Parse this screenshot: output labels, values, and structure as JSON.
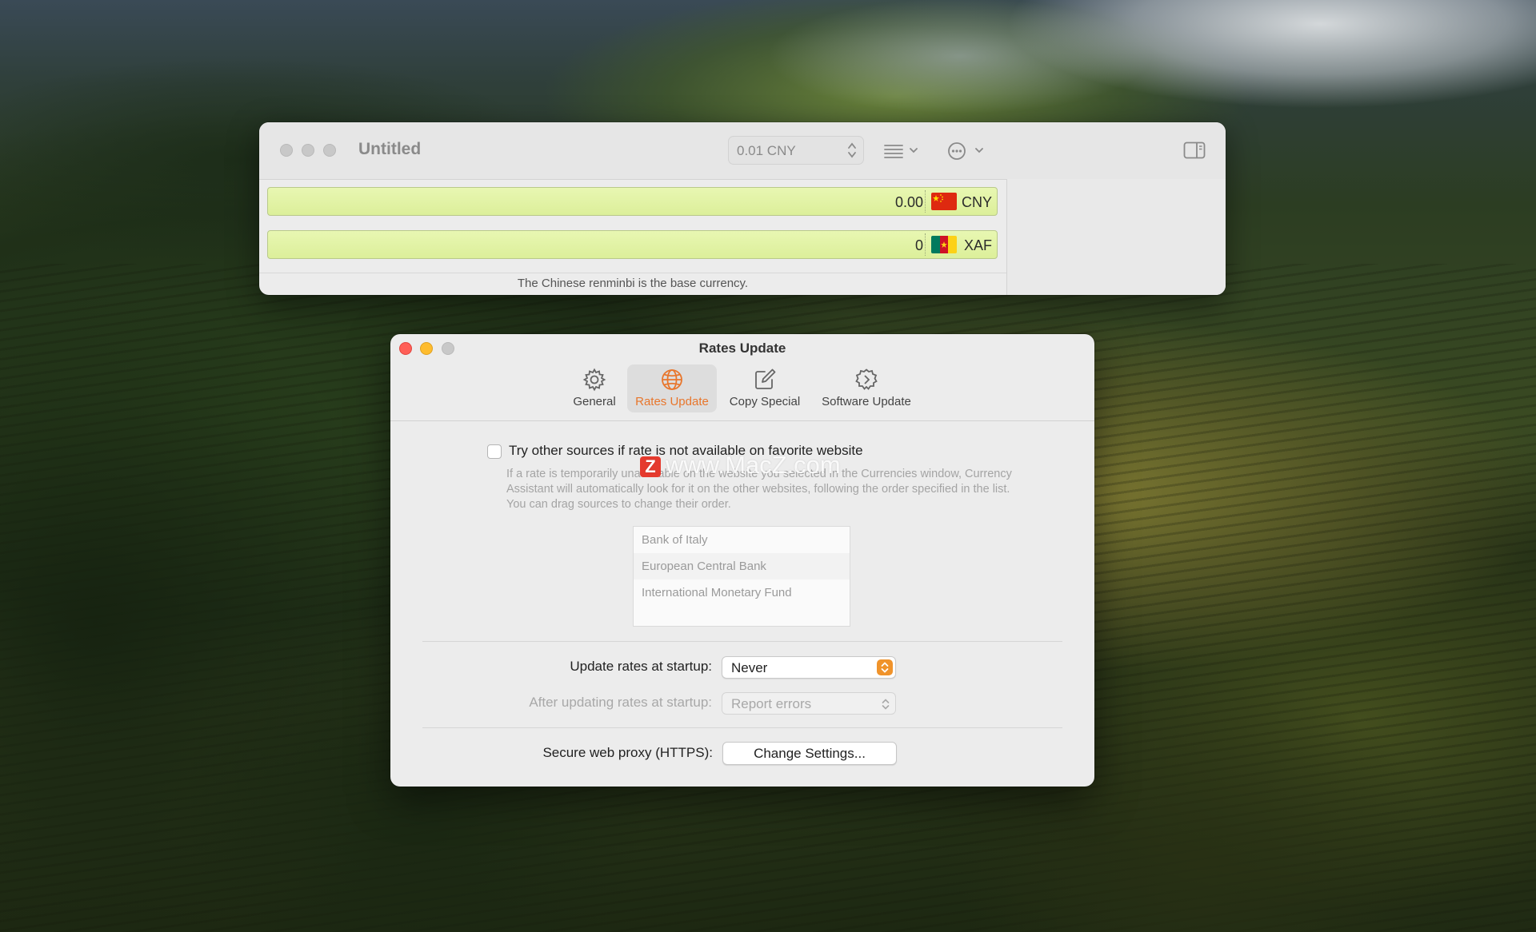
{
  "main_window": {
    "title": "Untitled",
    "amount_step": "0.01 CNY",
    "rows": [
      {
        "value": "0.00",
        "code": "CNY"
      },
      {
        "value": "0",
        "code": "XAF"
      }
    ],
    "status": "The Chinese renminbi is the base currency."
  },
  "prefs": {
    "window_title": "Rates Update",
    "tabs": [
      {
        "label": "General",
        "icon": "gear-icon"
      },
      {
        "label": "Rates Update",
        "icon": "globe-icon",
        "active": true
      },
      {
        "label": "Copy Special",
        "icon": "edit-square-icon"
      },
      {
        "label": "Software Update",
        "icon": "gear-badge-icon"
      }
    ],
    "try_other_sources": {
      "label": "Try other sources if rate is not available on favorite website",
      "checked": false,
      "help": "If a rate is temporarily unavailable on the website you selected in the Currencies window, Currency Assistant will automatically look for it on the other websites, following the order specified in the list. You can drag sources to change their order."
    },
    "sources": [
      "Bank of Italy",
      "European Central Bank",
      "International Monetary Fund"
    ],
    "update_at_startup": {
      "label": "Update rates at startup:",
      "value": "Never"
    },
    "after_update": {
      "label": "After updating rates at startup:",
      "value": "Report errors"
    },
    "proxy": {
      "label": "Secure web proxy (HTTPS):",
      "button": "Change Settings..."
    },
    "accent_color": "#e8762c"
  },
  "watermark": {
    "logo": "Z",
    "text": "www.MacZ.com"
  }
}
